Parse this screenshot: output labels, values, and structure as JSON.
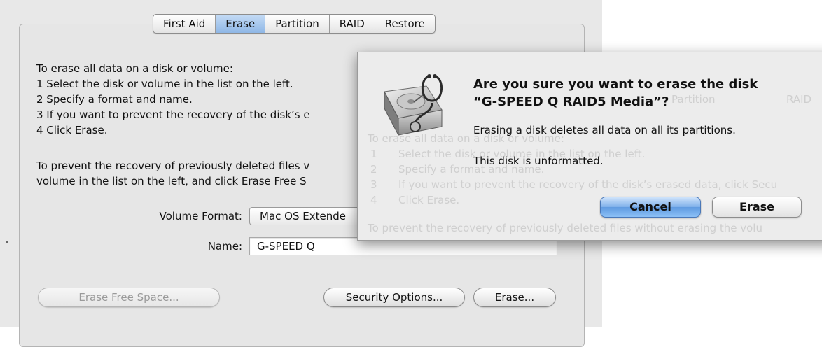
{
  "tabs": [
    "First Aid",
    "Erase",
    "Partition",
    "RAID",
    "Restore"
  ],
  "active_tab": "Erase",
  "instructions": {
    "line1": "To erase all data on a disk or volume:",
    "line2": "1 Select the disk or volume in the list on the left.",
    "line3": "2 Specify a format and name.",
    "line4": "3 If you want to prevent the recovery of the disk’s e",
    "line5": "4 Click Erase.",
    "line6": "To prevent the recovery of previously deleted files v",
    "line7": "volume in the list on the left, and click Erase Free S"
  },
  "form": {
    "volume_format_label": "Volume Format:",
    "volume_format_value": "Mac OS Extende",
    "name_label": "Name:",
    "name_value": "G-SPEED Q"
  },
  "buttons": {
    "erase_free_space": "Erase Free Space...",
    "security_options": "Security Options...",
    "erase": "Erase..."
  },
  "dialog": {
    "title_line1": "Are you sure you want to erase the disk",
    "title_line2": "“G-SPEED Q RAID5 Media”?",
    "message": "Erasing a disk deletes all data on all its partitions.",
    "detail": "This disk is unformatted.",
    "cancel": "Cancel",
    "erase": "Erase",
    "icon": "disk-utility-icon",
    "default_button_color": "#6fa6e8"
  },
  "ghost": {
    "tab1": "Partition",
    "tab2": "RAID",
    "line1": "To erase all data on a disk or volume:",
    "n1": "1",
    "t1": "Select the disk or volume in the list on the left.",
    "n2": "2",
    "t2": "Specify a format and name.",
    "n3": "3",
    "t3": "If you want to prevent the recovery of the disk’s erased data, click Secu",
    "n4": "4",
    "t4": "Click Erase.",
    "line6": "To prevent the recovery of previously deleted files without erasing the volu"
  }
}
